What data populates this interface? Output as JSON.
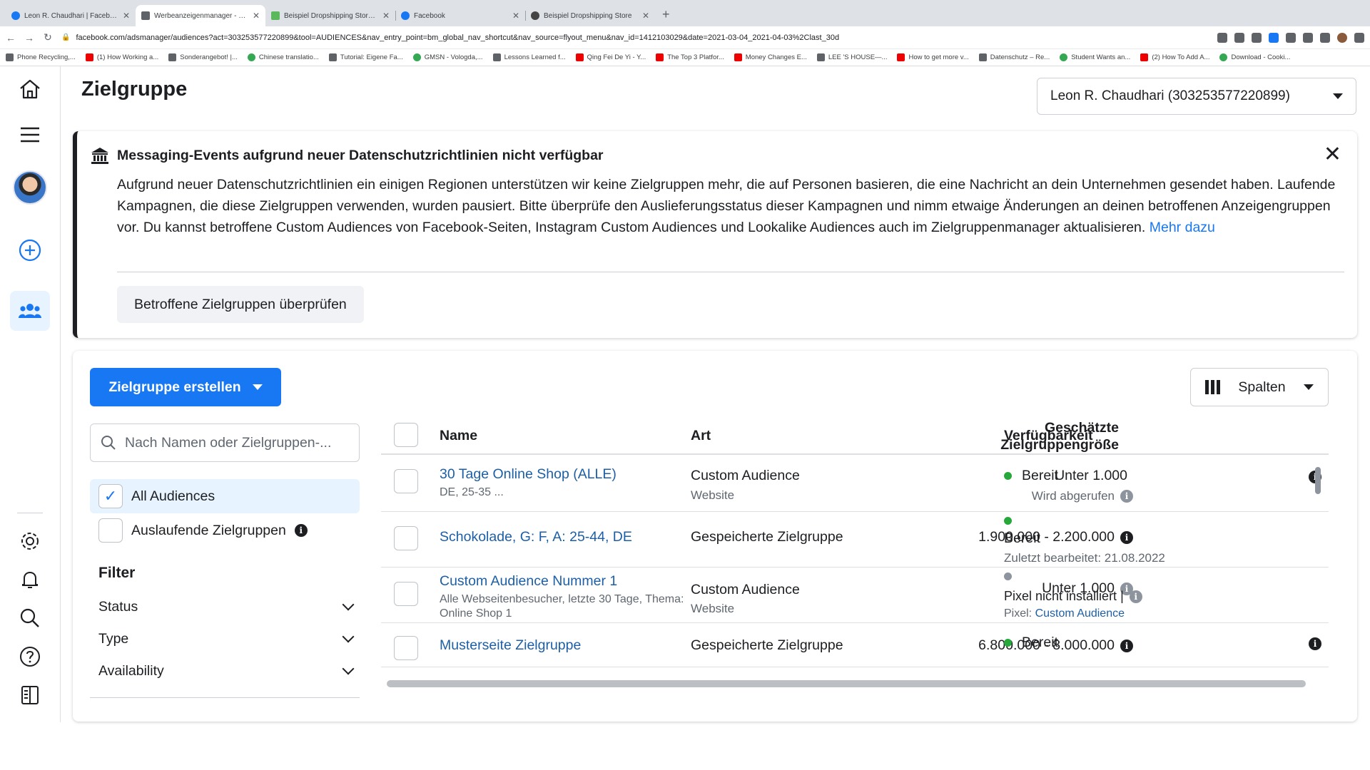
{
  "browser": {
    "tabs": [
      {
        "title": "Leon R. Chaudhari | Facebook",
        "favicon": "facebook-icon"
      },
      {
        "title": "Werbeanzeigenmanager - Ziel",
        "favicon": "ads-manager-icon",
        "active": true
      },
      {
        "title": "Beispiel Dropshipping Store - F",
        "favicon": "shopify-icon"
      },
      {
        "title": "Facebook",
        "favicon": "facebook-icon"
      },
      {
        "title": "Beispiel Dropshipping Store",
        "favicon": "store-icon"
      }
    ],
    "url": "facebook.com/adsmanager/audiences?act=303253577220899&tool=AUDIENCES&nav_entry_point=bm_global_nav_shortcut&nav_source=flyout_menu&nav_id=1412103029&date=2021-03-04_2021-04-03%2Clast_30d",
    "bookmarks": [
      "Phone Recycling,...",
      "(1) How Working a...",
      "Sonderangebot! |...",
      "Chinese translatio...",
      "Tutorial: Eigene Fa...",
      "GMSN - Vologda,...",
      "Lessons Learned f...",
      "Qing Fei De Yi - Y...",
      "The Top 3 Platfor...",
      "Money Changes E...",
      "LEE 'S HOUSE—...",
      "How to get more v...",
      "Datenschutz – Re...",
      "Student Wants an...",
      "(2) How To Add A...",
      "Download - Cooki..."
    ]
  },
  "page": {
    "title": "Zielgruppe",
    "account_select": "Leon R. Chaudhari (303253577220899)"
  },
  "banner": {
    "title": "Messaging-Events aufgrund neuer Datenschutzrichtlinien nicht verfügbar",
    "body": "Aufgrund neuer Datenschutzrichtlinien ein einigen Regionen unterstützen wir keine Zielgruppen mehr, die auf Personen basieren, die eine Nachricht an dein Unternehmen gesendet haben. Laufende Kampagnen, die diese Zielgruppen verwenden, wurden pausiert. Bitte überprüfe den Auslieferungsstatus dieser Kampagnen und nimm etwaige Änderungen an deinen betroffenen Anzeigengruppen vor. Du kannst betroffene Custom Audiences von Facebook-Seiten, Instagram Custom Audiences und Lookalike Audiences auch im Zielgruppenmanager aktualisieren.",
    "link": "Mehr dazu",
    "button": "Betroffene Zielgruppen überprüfen"
  },
  "toolbar": {
    "create_button": "Zielgruppe erstellen",
    "columns_button": "Spalten"
  },
  "sidebar": {
    "search_placeholder": "Nach Namen oder Zielgruppen-...",
    "audiences": [
      {
        "label": "All Audiences",
        "checked": true
      },
      {
        "label": "Auslaufende Zielgruppen",
        "checked": false
      }
    ],
    "filter_title": "Filter",
    "filters": [
      "Status",
      "Type",
      "Availability"
    ]
  },
  "table": {
    "headers": {
      "name": "Name",
      "type": "Art",
      "size_line1": "Geschätzte",
      "size_line2": "Zielgruppengröße",
      "availability": "Verfügbarkeit"
    },
    "rows": [
      {
        "name": "30 Tage Online Shop (ALLE)",
        "name_sub": "DE, 25-35 ...",
        "type": "Custom Audience",
        "type_sub": "Website",
        "size": "Unter 1.000",
        "size_sub": "Wird abgerufen",
        "status_color": "green",
        "availability": "Bereit",
        "availability_sub": ""
      },
      {
        "name": "Schokolade, G: F, A: 25-44, DE",
        "name_sub": "",
        "type": "Gespeicherte Zielgruppe",
        "type_sub": "",
        "size": "1.900.000 - 2.200.000",
        "size_sub": "",
        "status_color": "green",
        "availability": "Bereit",
        "availability_sub": "Zuletzt bearbeitet: 21.08.2022"
      },
      {
        "name": "Custom Audience Nummer 1",
        "name_sub_line1": "Alle Webseitenbesucher, letzte 30 Tage, Thema:",
        "name_sub_line2": "Online Shop 1",
        "type": "Custom Audience",
        "type_sub": "Website",
        "size": "Unter 1.000",
        "size_sub": "",
        "status_color": "gray",
        "availability": "Pixel nicht installiert |",
        "availability_sub_prefix": "Pixel:",
        "availability_sub_link": "Custom Audience"
      },
      {
        "name": "Musterseite Zielgruppe",
        "name_sub": "",
        "type": "Gespeicherte Zielgruppe",
        "type_sub": "",
        "size": "6.800.000 - 8.000.000",
        "size_sub": "",
        "status_color": "green",
        "availability": "Bereit",
        "availability_sub": ""
      }
    ]
  },
  "colors": {
    "brand_blue": "#1877f2",
    "link_blue": "#1d5fa6",
    "ready_green": "#27a83a",
    "selected_bg": "#e7f3ff"
  }
}
